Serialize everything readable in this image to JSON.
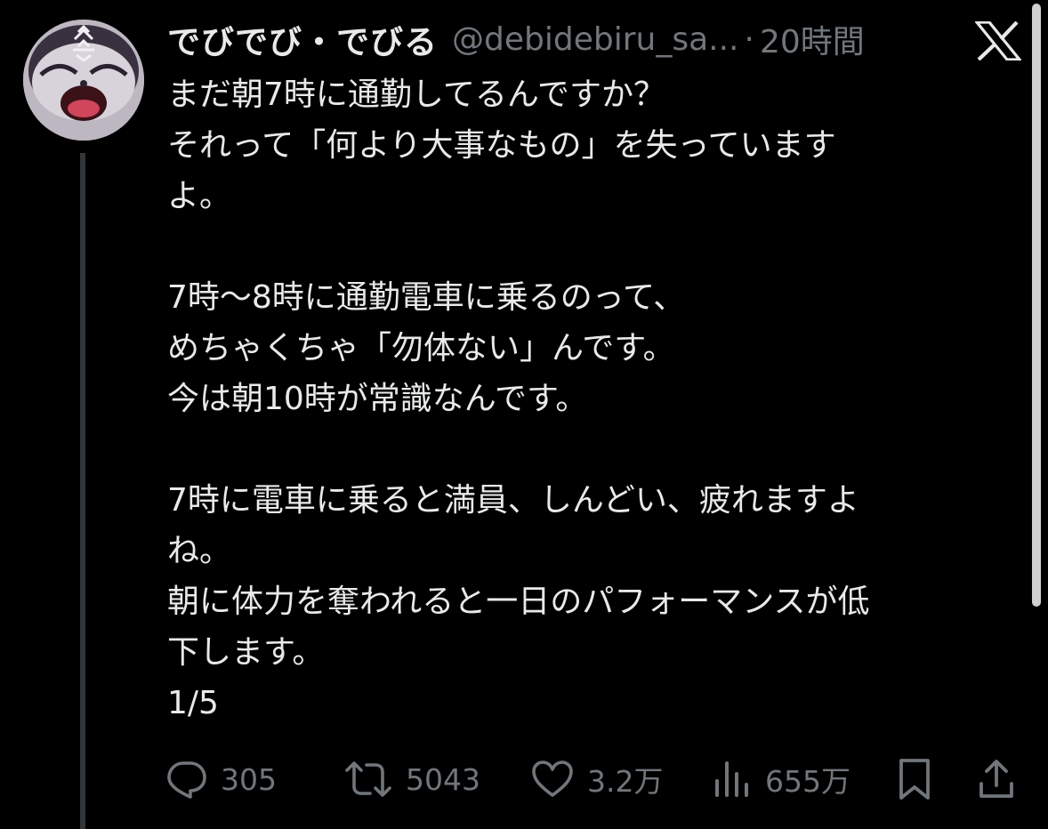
{
  "tweet": {
    "author": {
      "display_name": "でびでび・でびる",
      "handle": "@debidebiru_sa...",
      "separator": "·",
      "time": "20時間"
    },
    "paragraphs": [
      [
        "まだ朝7時に通勤してるんですか？",
        "それって「何より大事なもの」を失っています",
        "よ。"
      ],
      [
        "7時〜8時に通勤電車に乗るのって、",
        "めちゃくちゃ「勿体ない」んです。",
        "今は朝10時が常識なんです。"
      ],
      [
        "7時に電車に乗ると満員、しんどい、疲れますよ",
        "ね。",
        "朝に体力を奪われると一日のパフォーマンスが低",
        "下します。",
        "1/5"
      ]
    ],
    "actions": {
      "reply": {
        "icon": "reply-bubble-icon",
        "count": "305"
      },
      "retweet": {
        "icon": "retweet-icon",
        "count": "5043"
      },
      "like": {
        "icon": "heart-icon",
        "count": "3.2万"
      },
      "views": {
        "icon": "analytics-bars-icon",
        "count": "655万"
      },
      "bookmark": {
        "icon": "bookmark-icon"
      },
      "share": {
        "icon": "share-upload-icon"
      }
    }
  },
  "brand": {
    "logo": "x-logo-icon"
  },
  "colors": {
    "background": "#000000",
    "text_primary": "#e7e9ea",
    "text_secondary": "#71767b",
    "thread_line": "#333639",
    "scrollbar": "#d0d0d0"
  }
}
